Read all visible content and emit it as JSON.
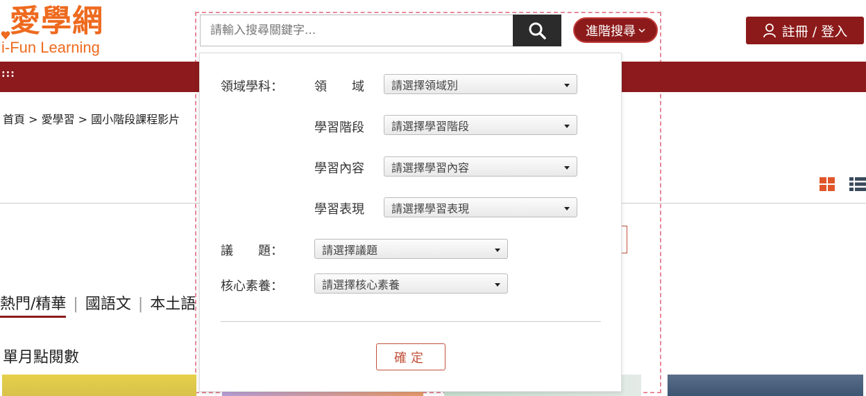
{
  "logo": {
    "name_cn": "愛學網",
    "name_en": "i-Fun Learning"
  },
  "search": {
    "placeholder": "請輸入搜尋關鍵字..."
  },
  "header": {
    "advanced_label": "進階搜尋",
    "login_label": "註冊 / 登入"
  },
  "nav": {
    "dots": ":::"
  },
  "breadcrumb": "首頁 > 愛學習 > 國小階段課程影片",
  "tabs": [
    {
      "label": "熱門/精華",
      "active": true
    },
    {
      "label": "國語文"
    },
    {
      "label": "本土語"
    }
  ],
  "section": {
    "title": "單月點閱數"
  },
  "advanced_search": {
    "domain_label": "領域學科：",
    "field_domain": {
      "label": "領　　域",
      "placeholder": "請選擇領域別"
    },
    "field_stage": {
      "label": "學習階段",
      "placeholder": "請選擇學習階段"
    },
    "field_content": {
      "label": "學習內容",
      "placeholder": "請選擇學習內容"
    },
    "field_performance": {
      "label": "學習表現",
      "placeholder": "請選擇學習表現"
    },
    "issue": {
      "label": "議　　題：",
      "placeholder": "請選擇議題"
    },
    "competency": {
      "label": "核心素養：",
      "placeholder": "請選擇核心素養"
    },
    "confirm_label": "確定"
  },
  "colors": {
    "brand_orange": "#ee6a1f",
    "brand_red": "#8c1a1a",
    "nav_red": "#8d1a1c",
    "accent_red": "#c0503a"
  }
}
